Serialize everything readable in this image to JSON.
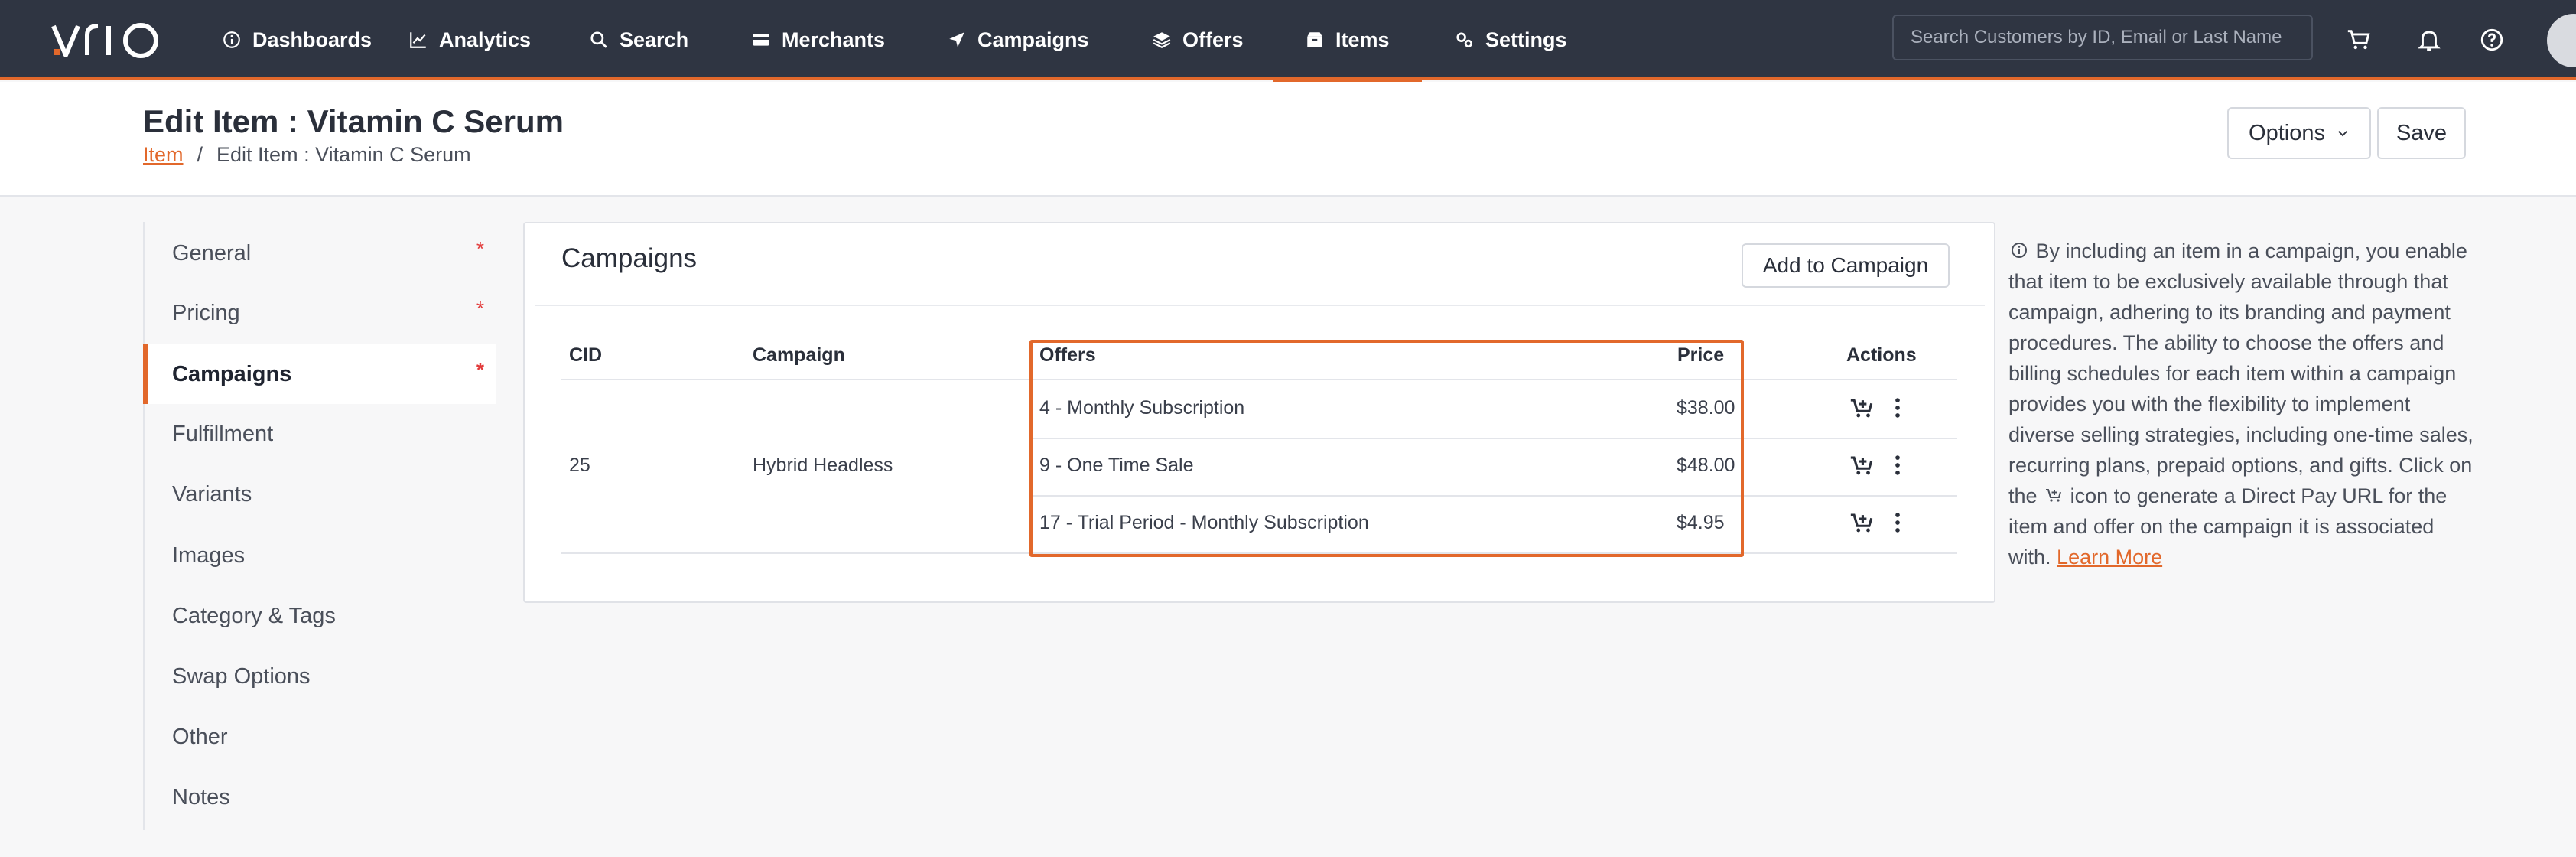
{
  "nav": {
    "logo": "vrio",
    "items": [
      {
        "label": "Dashboards",
        "icon": "info-circle-icon"
      },
      {
        "label": "Analytics",
        "icon": "line-chart-icon"
      },
      {
        "label": "Search",
        "icon": "search-icon"
      },
      {
        "label": "Merchants",
        "icon": "credit-card-icon"
      },
      {
        "label": "Campaigns",
        "icon": "send-arrow-icon"
      },
      {
        "label": "Offers",
        "icon": "layers-icon"
      },
      {
        "label": "Items",
        "icon": "box-icon",
        "active": true
      },
      {
        "label": "Settings",
        "icon": "gears-icon"
      }
    ],
    "search_placeholder": "Search Customers by ID, Email or Last Name"
  },
  "header": {
    "title": "Edit Item : Vitamin C Serum",
    "breadcrumb": [
      "Item",
      "/",
      "Edit Item : Vitamin C Serum"
    ],
    "options_label": "Options",
    "save_label": "Save"
  },
  "sidebar": {
    "items": [
      {
        "label": "General",
        "required": "*"
      },
      {
        "label": "Pricing",
        "required": "*"
      },
      {
        "label": "Campaigns",
        "required": "*",
        "active": true
      },
      {
        "label": "Fulfillment"
      },
      {
        "label": "Variants"
      },
      {
        "label": "Images"
      },
      {
        "label": "Category & Tags"
      },
      {
        "label": "Swap Options"
      },
      {
        "label": "Other"
      },
      {
        "label": "Notes"
      }
    ]
  },
  "campaigns": {
    "title": "Campaigns",
    "add_label": "Add to Campaign",
    "columns": [
      "CID",
      "Campaign",
      "Offers",
      "Price",
      "Actions"
    ],
    "cid": "25",
    "campaign": "Hybrid Headless",
    "rows": [
      {
        "offer": "4 - Monthly Subscription",
        "price": "$38.00"
      },
      {
        "offer": "9 - One Time Sale",
        "price": "$48.00"
      },
      {
        "offer": "17 - Trial Period - Monthly Subscription",
        "price": "$4.95"
      }
    ]
  },
  "info": {
    "text_before": "By including an item in a campaign, you enable that item to be exclusively available through that campaign, adhering to its branding and payment procedures. The ability to choose the offers and billing schedules for each item within a campaign provides you with the flexibility to implement diverse selling strategies, including one-time sales, recurring plans, prepaid options, and gifts. Click on the",
    "text_after": "icon to generate a Direct Pay URL for the item and offer on the campaign it is associated with.",
    "learn_more": "Learn More"
  },
  "colors": {
    "nav_bg": "#2f3542",
    "accent": "#e2682b",
    "required": "#e23b3b"
  }
}
